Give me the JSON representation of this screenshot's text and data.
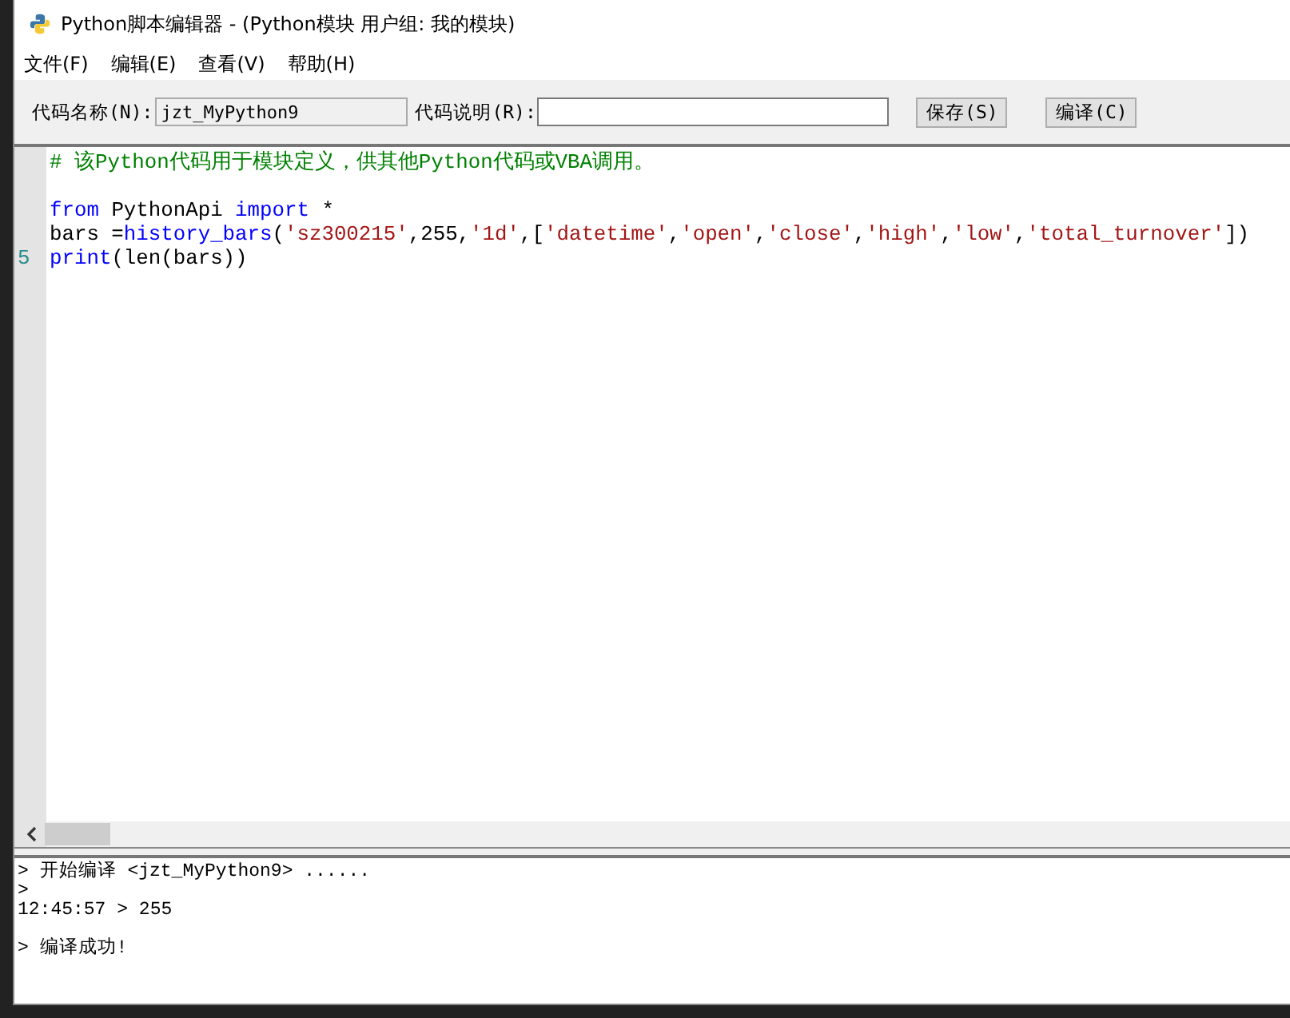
{
  "window": {
    "title": "Python脚本编辑器 - (Python模块 用户组: 我的模块)"
  },
  "menu": [
    "文件(F)",
    "编辑(E)",
    "查看(V)",
    "帮助(H)"
  ],
  "toolbar": {
    "name_label": "代码名称(N):",
    "name_field": {
      "value": "jzt_MyPython9",
      "disabled": true
    },
    "desc_label": "代码说明(R):",
    "buttons": [
      "保存(S)",
      "编译(C)"
    ]
  },
  "editor": {
    "lines": [
      {
        "tokens": [
          {
            "kind": "comment",
            "text": "# 该Python代码用于模块定义，供其他Python代码或VBA调用。"
          }
        ]
      },
      {
        "kind": "blank"
      },
      {
        "tokens": [
          {
            "kind": "keyword",
            "text": "from"
          },
          {
            "kind": "plain",
            "text": " PythonApi "
          },
          {
            "kind": "keyword",
            "text": "import"
          },
          {
            "kind": "plain",
            "text": " *"
          }
        ]
      },
      {
        "tokens": [
          {
            "kind": "plain",
            "text": "bars ="
          },
          {
            "kind": "keyword",
            "text": "history_bars"
          },
          {
            "kind": "plain",
            "text": "("
          },
          {
            "kind": "string",
            "text": "'sz300215'"
          },
          {
            "kind": "plain",
            "text": ",255,"
          },
          {
            "kind": "string",
            "text": "'1d'"
          },
          {
            "kind": "plain",
            "text": ",["
          },
          {
            "kind": "string",
            "text": "'datetime'"
          },
          {
            "kind": "plain",
            "text": ","
          },
          {
            "kind": "string",
            "text": "'open'"
          },
          {
            "kind": "plain",
            "text": ","
          },
          {
            "kind": "string",
            "text": "'close'"
          },
          {
            "kind": "plain",
            "text": ","
          },
          {
            "kind": "string",
            "text": "'high'"
          },
          {
            "kind": "plain",
            "text": ","
          },
          {
            "kind": "string",
            "text": "'low'"
          },
          {
            "kind": "plain",
            "text": ","
          },
          {
            "kind": "string",
            "text": "'total_turnover'"
          },
          {
            "kind": "plain",
            "text": "])"
          }
        ]
      },
      {
        "number": "5",
        "tokens": [
          {
            "kind": "keyword",
            "text": "print"
          },
          {
            "kind": "plain",
            "text": "(len(bars))"
          }
        ]
      }
    ]
  },
  "output": {
    "lines": [
      {
        "kind": "text",
        "text": "> 开始编译 <jzt_MyPython9> ......"
      },
      {
        "kind": "text",
        "text": ">"
      },
      {
        "kind": "text",
        "text": "12:45:57 > 255"
      },
      {
        "kind": "blank"
      },
      {
        "kind": "text",
        "text": "> 编译成功!"
      }
    ]
  }
}
